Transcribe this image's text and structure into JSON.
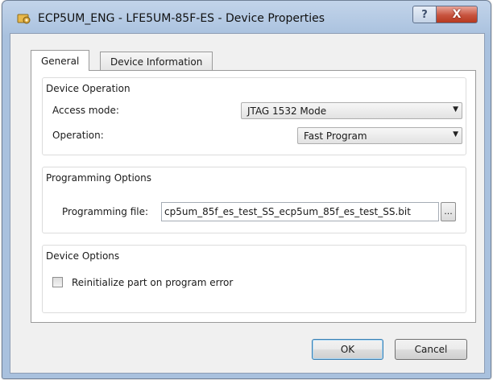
{
  "window": {
    "title": "ECP5UM_ENG - LFE5UM-85F-ES - Device Properties",
    "help_label": "?",
    "close_label": "X"
  },
  "tabs": [
    {
      "label": "General",
      "selected": true
    },
    {
      "label": "Device Information",
      "selected": false
    }
  ],
  "device_operation": {
    "title": "Device Operation",
    "access_mode_label": "Access mode:",
    "access_mode_value": "JTAG 1532 Mode",
    "operation_label": "Operation:",
    "operation_value": "Fast Program"
  },
  "programming_options": {
    "title": "Programming Options",
    "file_label": "Programming file:",
    "file_value": "cp5um_85f_es_test_SS_ecp5um_85f_es_test_SS.bit",
    "browse_label": "..."
  },
  "device_options": {
    "title": "Device Options",
    "reinit_label": "Reinitialize part on program error",
    "reinit_checked": false
  },
  "footer": {
    "ok_label": "OK",
    "cancel_label": "Cancel"
  },
  "icons": {
    "app": "gear-chip-icon",
    "dropdown": "chevron-down-icon"
  }
}
